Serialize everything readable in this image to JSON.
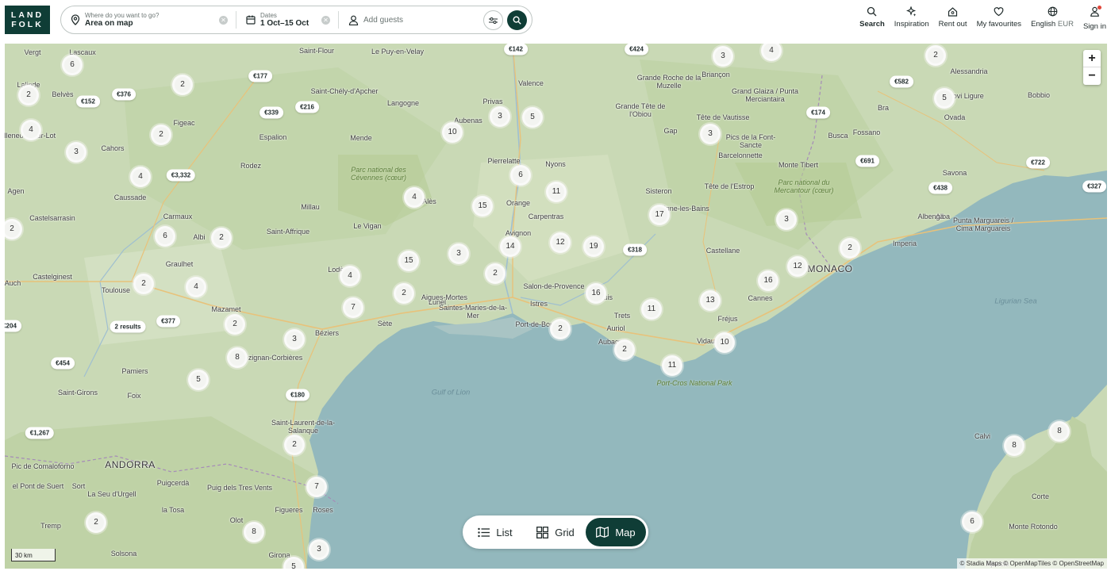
{
  "logo": {
    "line1": "LAND",
    "line2": "FOLK"
  },
  "search": {
    "where_label": "Where do you want to go?",
    "where_value": "Area on map",
    "dates_label": "Dates",
    "dates_value": "1 Oct–15 Oct",
    "guests_placeholder": "Add guests"
  },
  "nav": {
    "search": "Search",
    "inspiration": "Inspiration",
    "rent_out": "Rent out",
    "favourites": "My favourites",
    "language": "English",
    "currency": "EUR",
    "sign_in": "Sign in"
  },
  "map": {
    "places": [
      {
        "t": "Vergt"
      },
      {
        "t": "Lascaux"
      },
      {
        "t": "Lalinde"
      },
      {
        "t": "Belvès"
      },
      {
        "t": "Figeac"
      },
      {
        "t": "Villeneuve-sur-Lot"
      },
      {
        "t": "Cahors"
      },
      {
        "t": "Agen"
      },
      {
        "t": "Caussade"
      },
      {
        "t": "Castelsarrasin"
      },
      {
        "t": "Carmaux"
      },
      {
        "t": "Albi"
      },
      {
        "t": "Graulhet"
      },
      {
        "t": "Castelginest"
      },
      {
        "t": "Toulouse"
      },
      {
        "t": "Auch"
      },
      {
        "t": "Mazamet"
      },
      {
        "t": "Pamiers"
      },
      {
        "t": "Saint-Girons"
      },
      {
        "t": "Foix"
      },
      {
        "t": "ANDORRA"
      },
      {
        "t": "Pic de Comaloforno"
      },
      {
        "t": "el Pont de Suert"
      },
      {
        "t": "Sort"
      },
      {
        "t": "La Seu d'Urgell"
      },
      {
        "t": "Puigcerdà"
      },
      {
        "t": "Puig dels Tres Vents"
      },
      {
        "t": "la Tosa"
      },
      {
        "t": "Olot"
      },
      {
        "t": "Tremp"
      },
      {
        "t": "Solsona"
      },
      {
        "t": "Girona"
      },
      {
        "t": "Figueres"
      },
      {
        "t": "Roses"
      },
      {
        "t": "Saint-Laurent-de-la-Salanque"
      },
      {
        "t": "Perpignan"
      },
      {
        "t": "Lézignan-Corbières"
      },
      {
        "t": "Béziers"
      },
      {
        "t": "Sète"
      },
      {
        "t": "Lodève"
      },
      {
        "t": "Saint-Affrique"
      },
      {
        "t": "Millau"
      },
      {
        "t": "Le Vigan"
      },
      {
        "t": "Rodez"
      },
      {
        "t": "Espalion"
      },
      {
        "t": "Saint-Flour"
      },
      {
        "t": "Saint-Chély-d'Apcher"
      },
      {
        "t": "Langogne"
      },
      {
        "t": "Mende"
      },
      {
        "t": "Alès"
      },
      {
        "t": "Le Puy-en-Velay"
      },
      {
        "t": "Privas"
      },
      {
        "t": "Aubenas"
      },
      {
        "t": "Valence"
      },
      {
        "t": "Pierrelatte"
      },
      {
        "t": "Nyons"
      },
      {
        "t": "Orange"
      },
      {
        "t": "Carpentras"
      },
      {
        "t": "Avignon"
      },
      {
        "t": "Lunel"
      },
      {
        "t": "Aigues-Mortes"
      },
      {
        "t": "Saintes-Maries-de-la-Mer"
      },
      {
        "t": "Salon-de-Provence"
      },
      {
        "t": "Istres"
      },
      {
        "t": "Port-de-Bouc"
      },
      {
        "t": "Pertuis"
      },
      {
        "t": "Trets"
      },
      {
        "t": "Auriol"
      },
      {
        "t": "Aubagne"
      },
      {
        "t": "Vidauban"
      },
      {
        "t": "Fréjus"
      },
      {
        "t": "Cannes"
      },
      {
        "t": "MONACO"
      },
      {
        "t": "Imperia"
      },
      {
        "t": "Castellane"
      },
      {
        "t": "Digne-les-Bains"
      },
      {
        "t": "Sisteron"
      },
      {
        "t": "Gap"
      },
      {
        "t": "Briançon"
      },
      {
        "t": "Barcelonnette"
      },
      {
        "t": "Alessandria"
      },
      {
        "t": "Bra"
      },
      {
        "t": "Alba"
      },
      {
        "t": "Novi Ligure"
      },
      {
        "t": "Bobbio"
      },
      {
        "t": "Ovada"
      },
      {
        "t": "Fossano"
      },
      {
        "t": "Busca"
      },
      {
        "t": "Savona"
      },
      {
        "t": "Albenga"
      },
      {
        "t": "Monte Tibert"
      },
      {
        "t": "Calvi"
      },
      {
        "t": "Corte"
      },
      {
        "t": "Monte Rotondo"
      },
      {
        "t": "Ajaccio"
      },
      {
        "t": "Grande Roche de la Muzelle"
      },
      {
        "t": "Grande Tête de l'Obiou"
      },
      {
        "t": "Grand Glaiza / Punta Merciantaira"
      },
      {
        "t": "Tête de Vautisse"
      },
      {
        "t": "Pics de la Font-Sancte"
      },
      {
        "t": "Tête de l'Estrop"
      },
      {
        "t": "Punta Marguareis / Cima Marguareis"
      }
    ],
    "sea_labels": [
      "Gulf of Lion",
      "Ligurian Sea"
    ],
    "park_labels": [
      "Parc national des Cévennes (cœur)",
      "Parc national du Mercantour (cœur)",
      "Port-Cros National Park"
    ],
    "clusters": [
      "6",
      "2",
      "2",
      "4",
      "2",
      "3",
      "4",
      "2",
      "6",
      "2",
      "2",
      "4",
      "2",
      "3",
      "8",
      "5",
      "2",
      "3",
      "7",
      "4",
      "4",
      "15",
      "15",
      "10",
      "5",
      "6",
      "11",
      "14",
      "12",
      "19",
      "3",
      "2",
      "2",
      "16",
      "11",
      "2",
      "11",
      "13",
      "10",
      "16",
      "12",
      "17",
      "3",
      "3",
      "4",
      "2",
      "5",
      "3",
      "2",
      "8",
      "8",
      "6",
      "2",
      "7",
      "8",
      "2",
      "5",
      "3",
      "2 results"
    ],
    "price_pills": [
      "€142",
      "€424",
      "€177",
      "€339",
      "€216",
      "€152",
      "€376",
      "€3,332",
      "€377",
      "€454",
      "€204",
      "€180",
      "€1,267",
      "€318",
      "€582",
      "€174",
      "€691",
      "€722",
      "€438",
      "€327"
    ],
    "scale_label": "30 km",
    "attribution": "© Stadia Maps © OpenMapTiles © OpenStreetMap",
    "zoom_in": "+",
    "zoom_out": "−"
  },
  "view_toggle": {
    "list": "List",
    "grid": "Grid",
    "map": "Map",
    "active": "map"
  },
  "colors": {
    "brand": "#0f3d36",
    "land": "#c9d9b5",
    "sea": "#93b8bd"
  }
}
